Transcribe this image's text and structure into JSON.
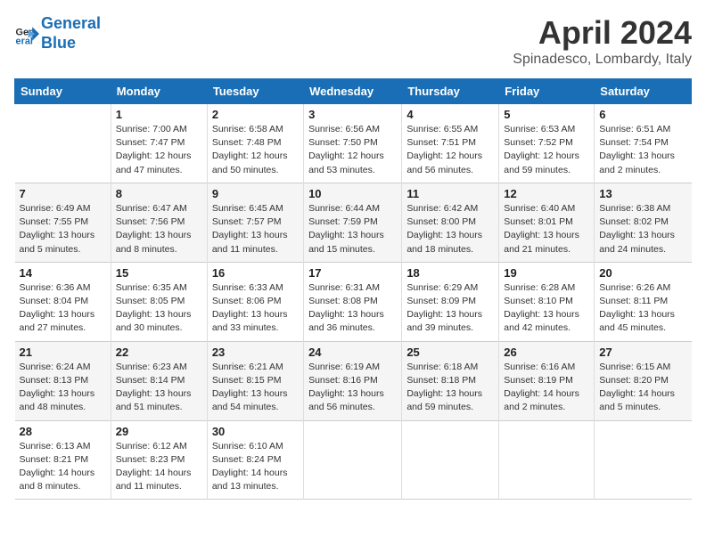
{
  "header": {
    "logo_line1": "General",
    "logo_line2": "Blue",
    "month": "April 2024",
    "location": "Spinadesco, Lombardy, Italy"
  },
  "days_of_week": [
    "Sunday",
    "Monday",
    "Tuesday",
    "Wednesday",
    "Thursday",
    "Friday",
    "Saturday"
  ],
  "weeks": [
    [
      {
        "day": "",
        "info": ""
      },
      {
        "day": "1",
        "info": "Sunrise: 7:00 AM\nSunset: 7:47 PM\nDaylight: 12 hours\nand 47 minutes."
      },
      {
        "day": "2",
        "info": "Sunrise: 6:58 AM\nSunset: 7:48 PM\nDaylight: 12 hours\nand 50 minutes."
      },
      {
        "day": "3",
        "info": "Sunrise: 6:56 AM\nSunset: 7:50 PM\nDaylight: 12 hours\nand 53 minutes."
      },
      {
        "day": "4",
        "info": "Sunrise: 6:55 AM\nSunset: 7:51 PM\nDaylight: 12 hours\nand 56 minutes."
      },
      {
        "day": "5",
        "info": "Sunrise: 6:53 AM\nSunset: 7:52 PM\nDaylight: 12 hours\nand 59 minutes."
      },
      {
        "day": "6",
        "info": "Sunrise: 6:51 AM\nSunset: 7:54 PM\nDaylight: 13 hours\nand 2 minutes."
      }
    ],
    [
      {
        "day": "7",
        "info": "Sunrise: 6:49 AM\nSunset: 7:55 PM\nDaylight: 13 hours\nand 5 minutes."
      },
      {
        "day": "8",
        "info": "Sunrise: 6:47 AM\nSunset: 7:56 PM\nDaylight: 13 hours\nand 8 minutes."
      },
      {
        "day": "9",
        "info": "Sunrise: 6:45 AM\nSunset: 7:57 PM\nDaylight: 13 hours\nand 11 minutes."
      },
      {
        "day": "10",
        "info": "Sunrise: 6:44 AM\nSunset: 7:59 PM\nDaylight: 13 hours\nand 15 minutes."
      },
      {
        "day": "11",
        "info": "Sunrise: 6:42 AM\nSunset: 8:00 PM\nDaylight: 13 hours\nand 18 minutes."
      },
      {
        "day": "12",
        "info": "Sunrise: 6:40 AM\nSunset: 8:01 PM\nDaylight: 13 hours\nand 21 minutes."
      },
      {
        "day": "13",
        "info": "Sunrise: 6:38 AM\nSunset: 8:02 PM\nDaylight: 13 hours\nand 24 minutes."
      }
    ],
    [
      {
        "day": "14",
        "info": "Sunrise: 6:36 AM\nSunset: 8:04 PM\nDaylight: 13 hours\nand 27 minutes."
      },
      {
        "day": "15",
        "info": "Sunrise: 6:35 AM\nSunset: 8:05 PM\nDaylight: 13 hours\nand 30 minutes."
      },
      {
        "day": "16",
        "info": "Sunrise: 6:33 AM\nSunset: 8:06 PM\nDaylight: 13 hours\nand 33 minutes."
      },
      {
        "day": "17",
        "info": "Sunrise: 6:31 AM\nSunset: 8:08 PM\nDaylight: 13 hours\nand 36 minutes."
      },
      {
        "day": "18",
        "info": "Sunrise: 6:29 AM\nSunset: 8:09 PM\nDaylight: 13 hours\nand 39 minutes."
      },
      {
        "day": "19",
        "info": "Sunrise: 6:28 AM\nSunset: 8:10 PM\nDaylight: 13 hours\nand 42 minutes."
      },
      {
        "day": "20",
        "info": "Sunrise: 6:26 AM\nSunset: 8:11 PM\nDaylight: 13 hours\nand 45 minutes."
      }
    ],
    [
      {
        "day": "21",
        "info": "Sunrise: 6:24 AM\nSunset: 8:13 PM\nDaylight: 13 hours\nand 48 minutes."
      },
      {
        "day": "22",
        "info": "Sunrise: 6:23 AM\nSunset: 8:14 PM\nDaylight: 13 hours\nand 51 minutes."
      },
      {
        "day": "23",
        "info": "Sunrise: 6:21 AM\nSunset: 8:15 PM\nDaylight: 13 hours\nand 54 minutes."
      },
      {
        "day": "24",
        "info": "Sunrise: 6:19 AM\nSunset: 8:16 PM\nDaylight: 13 hours\nand 56 minutes."
      },
      {
        "day": "25",
        "info": "Sunrise: 6:18 AM\nSunset: 8:18 PM\nDaylight: 13 hours\nand 59 minutes."
      },
      {
        "day": "26",
        "info": "Sunrise: 6:16 AM\nSunset: 8:19 PM\nDaylight: 14 hours\nand 2 minutes."
      },
      {
        "day": "27",
        "info": "Sunrise: 6:15 AM\nSunset: 8:20 PM\nDaylight: 14 hours\nand 5 minutes."
      }
    ],
    [
      {
        "day": "28",
        "info": "Sunrise: 6:13 AM\nSunset: 8:21 PM\nDaylight: 14 hours\nand 8 minutes."
      },
      {
        "day": "29",
        "info": "Sunrise: 6:12 AM\nSunset: 8:23 PM\nDaylight: 14 hours\nand 11 minutes."
      },
      {
        "day": "30",
        "info": "Sunrise: 6:10 AM\nSunset: 8:24 PM\nDaylight: 14 hours\nand 13 minutes."
      },
      {
        "day": "",
        "info": ""
      },
      {
        "day": "",
        "info": ""
      },
      {
        "day": "",
        "info": ""
      },
      {
        "day": "",
        "info": ""
      }
    ]
  ]
}
